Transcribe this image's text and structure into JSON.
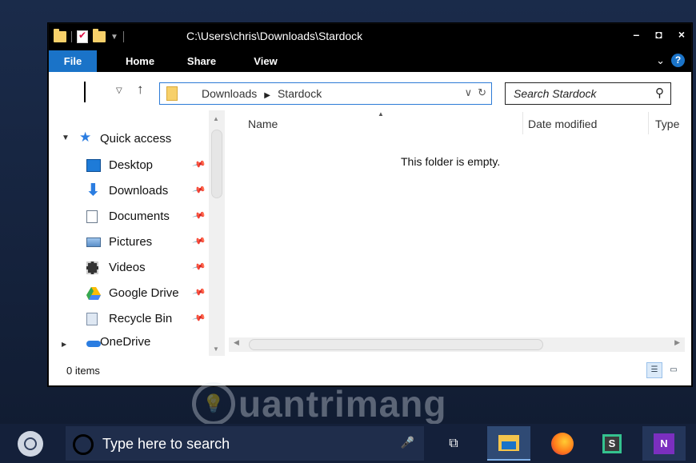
{
  "window": {
    "title": "C:\\Users\\chris\\Downloads\\Stardock",
    "controls": {
      "minimize": "–",
      "maximize": "◘",
      "close": "×"
    }
  },
  "ribbon": {
    "tabs": [
      "File",
      "Home",
      "Share",
      "View"
    ],
    "expand_icon": "chevron-down-icon",
    "help_label": "?"
  },
  "address": {
    "crumbs": [
      "Downloads",
      "Stardock"
    ],
    "dropdown_glyph": "∨",
    "refresh_glyph": "↻"
  },
  "search": {
    "placeholder": "Search Stardock"
  },
  "navigation": {
    "quick_access": "Quick access",
    "items": [
      {
        "label": "Desktop",
        "icon": "desktop-icon"
      },
      {
        "label": "Downloads",
        "icon": "download-icon"
      },
      {
        "label": "Documents",
        "icon": "documents-icon"
      },
      {
        "label": "Pictures",
        "icon": "pictures-icon"
      },
      {
        "label": "Videos",
        "icon": "videos-icon"
      },
      {
        "label": "Google Drive",
        "icon": "google-drive-icon"
      },
      {
        "label": "Recycle Bin",
        "icon": "recycle-bin-icon"
      }
    ],
    "next_partial": "OneDrive"
  },
  "columns": [
    "Name",
    "Date modified",
    "Type"
  ],
  "empty_message": "This folder is empty.",
  "status": {
    "items": "0 items"
  },
  "watermark": {
    "text": "uantrimang"
  },
  "taskbar": {
    "search_text": "Type here to search",
    "apps": [
      "file-explorer-icon",
      "firefox-icon",
      "slack-icon",
      "onenote-icon"
    ]
  },
  "colors": {
    "accent": "#1a73c8",
    "titlebar": "#000000",
    "taskbar": "#14203a"
  }
}
